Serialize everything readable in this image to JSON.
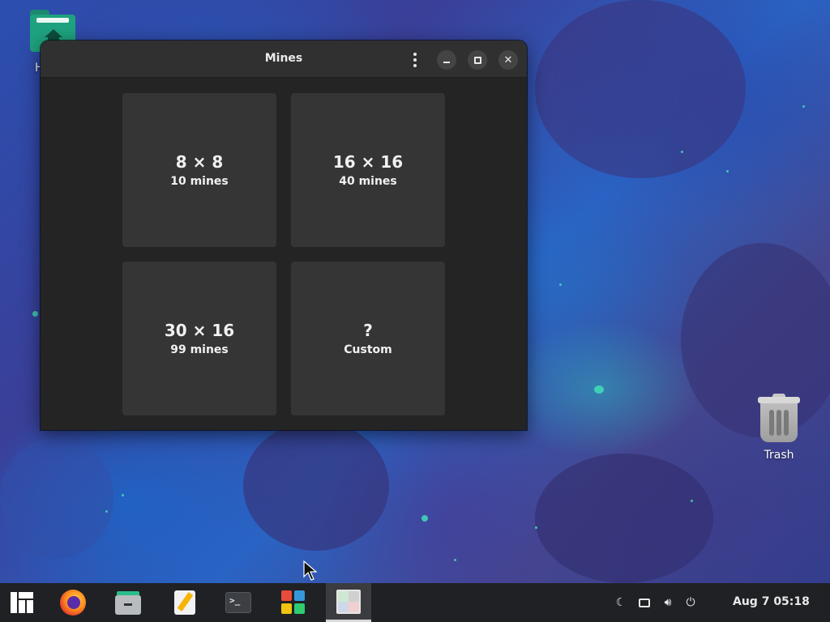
{
  "desktop": {
    "home_label": "H",
    "trash_label": "Trash"
  },
  "window": {
    "title": "Mines",
    "options": [
      {
        "size": "8 × 8",
        "detail": "10 mines"
      },
      {
        "size": "16 × 16",
        "detail": "40 mines"
      },
      {
        "size": "30 × 16",
        "detail": "99 mines"
      },
      {
        "size": "?",
        "detail": "Custom"
      }
    ]
  },
  "taskbar": {
    "apps": [
      "manjaro-menu-icon",
      "firefox-icon",
      "files-icon",
      "text-editor-icon",
      "terminal-icon",
      "software-icon",
      "mines-icon"
    ],
    "tray_icons": [
      "night-mode-icon",
      "display-icon",
      "volume-icon",
      "power-icon"
    ],
    "clock": "Aug 7  05:18"
  },
  "colors": {
    "window_bg": "#242424",
    "tile_bg": "#353535",
    "titlebar_bg": "#303030",
    "taskbar_bg": "#1f2124"
  }
}
